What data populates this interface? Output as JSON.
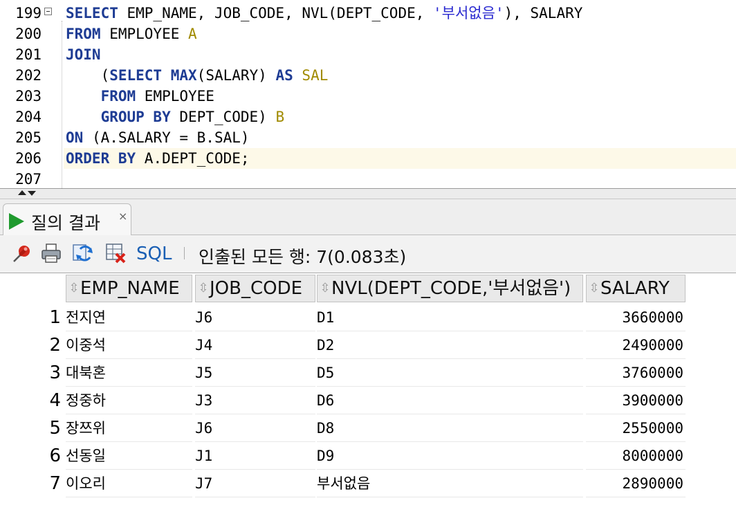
{
  "editor": {
    "line_numbers": [
      "199",
      "200",
      "201",
      "202",
      "203",
      "204",
      "205",
      "206",
      "207"
    ],
    "lines": [
      {
        "tokens": [
          {
            "t": "SELECT",
            "c": "kw"
          },
          {
            "t": " EMP_NAME, JOB_CODE, NVL(DEPT_CODE, "
          },
          {
            "t": "'부서없음'",
            "c": "st"
          },
          {
            "t": "), SALARY"
          }
        ]
      },
      {
        "tokens": [
          {
            "t": "FROM",
            "c": "kw"
          },
          {
            "t": " EMPLOYEE "
          },
          {
            "t": "A",
            "c": "al"
          }
        ]
      },
      {
        "tokens": [
          {
            "t": "JOIN",
            "c": "kw"
          }
        ]
      },
      {
        "tokens": [
          {
            "t": "    ("
          },
          {
            "t": "SELECT",
            "c": "kw"
          },
          {
            "t": " "
          },
          {
            "t": "MAX",
            "c": "kw"
          },
          {
            "t": "(SALARY) "
          },
          {
            "t": "AS",
            "c": "kw"
          },
          {
            "t": " "
          },
          {
            "t": "SAL",
            "c": "al"
          }
        ]
      },
      {
        "tokens": [
          {
            "t": "    "
          },
          {
            "t": "FROM",
            "c": "kw"
          },
          {
            "t": " EMPLOYEE"
          }
        ]
      },
      {
        "tokens": [
          {
            "t": "    "
          },
          {
            "t": "GROUP BY",
            "c": "kw"
          },
          {
            "t": " DEPT_CODE) "
          },
          {
            "t": "B",
            "c": "al"
          }
        ]
      },
      {
        "tokens": [
          {
            "t": "ON",
            "c": "kw"
          },
          {
            "t": " (A.SALARY = B.SAL)"
          }
        ]
      },
      {
        "tokens": [
          {
            "t": "ORDER BY",
            "c": "kw"
          },
          {
            "t": " A.DEPT_CODE;"
          }
        ]
      },
      {
        "tokens": []
      }
    ],
    "current_line_index": 7
  },
  "result_tab": {
    "label": "질의 결과",
    "close": "×"
  },
  "toolbar": {
    "icons": [
      "pin-icon",
      "print-icon",
      "refresh-icon",
      "export-icon"
    ],
    "sql_label": "SQL",
    "separator": "|",
    "status": "인출된 모든 행: 7(0.083초)"
  },
  "grid": {
    "columns": [
      "EMP_NAME",
      "JOB_CODE",
      "NVL(DEPT_CODE,'부서없음')",
      "SALARY"
    ],
    "sort_glyph": "⇳",
    "rows": [
      {
        "n": "1",
        "cells": [
          "전지연",
          "J6",
          "D1",
          "3660000"
        ]
      },
      {
        "n": "2",
        "cells": [
          "이중석",
          "J4",
          "D2",
          "2490000"
        ]
      },
      {
        "n": "3",
        "cells": [
          "대북혼",
          "J5",
          "D5",
          "3760000"
        ]
      },
      {
        "n": "4",
        "cells": [
          "정중하",
          "J3",
          "D6",
          "3900000"
        ]
      },
      {
        "n": "5",
        "cells": [
          "장쯔위",
          "J6",
          "D8",
          "2550000"
        ]
      },
      {
        "n": "6",
        "cells": [
          "선동일",
          "J1",
          "D9",
          "8000000"
        ]
      },
      {
        "n": "7",
        "cells": [
          "이오리",
          "J7",
          "부서없음",
          "2890000"
        ]
      }
    ]
  },
  "colors": {
    "keyword": "#1e3c94",
    "alias": "#a08a00",
    "string": "#2a2ad0",
    "current_line": "#fdf9e8",
    "run_icon": "#1f9a2e"
  }
}
